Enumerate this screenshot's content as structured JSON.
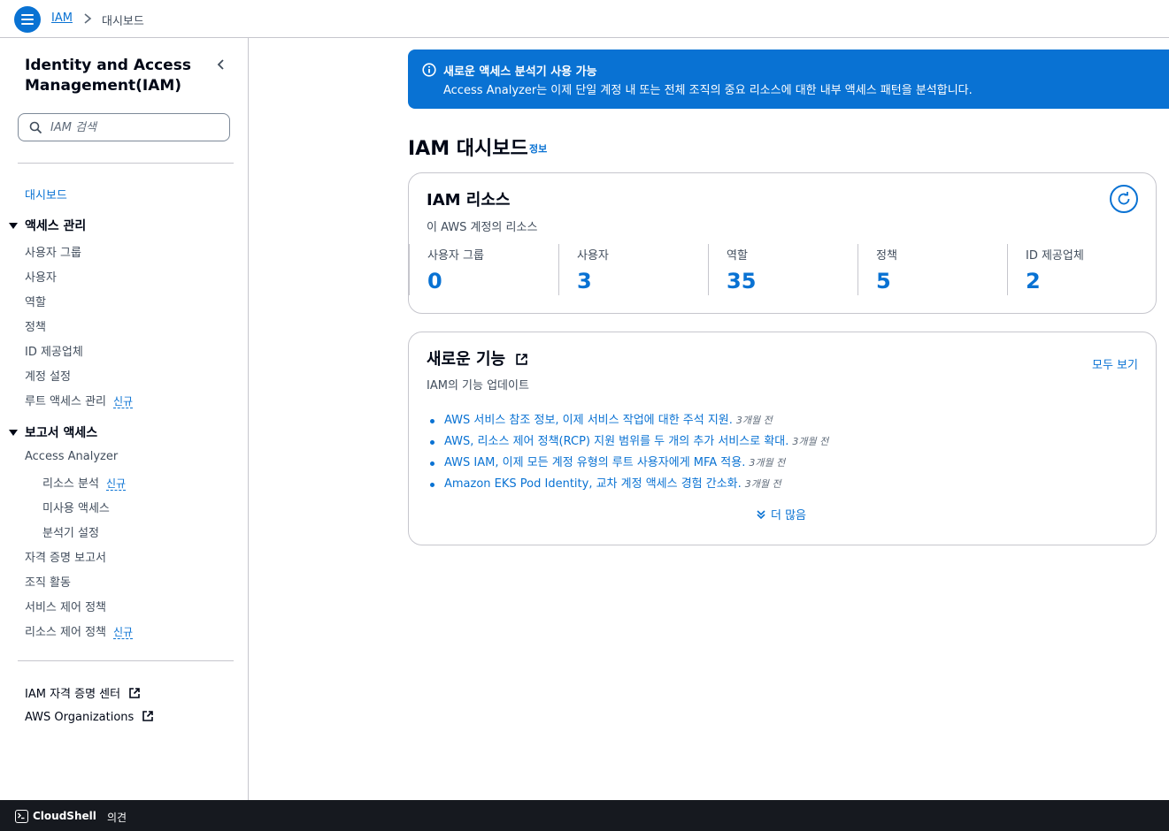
{
  "topbar": {
    "breadcrumb_root": "IAM",
    "breadcrumb_current": "대시보드"
  },
  "sidebar": {
    "title": "Identity and Access Management(IAM)",
    "search_placeholder": "IAM 검색",
    "dashboard": "대시보드",
    "section_access": "액세스 관리",
    "access_items": [
      "사용자 그룹",
      "사용자",
      "역할",
      "정책",
      "ID 제공업체",
      "계정 설정",
      "루트 액세스 관리"
    ],
    "section_reports": "보고서 액세스",
    "report_items": [
      "Access Analyzer",
      "리소스 분석",
      "미사용 액세스",
      "분석기 설정",
      "자격 증명 보고서",
      "조직 활동",
      "서비스 제어 정책",
      "리소스 제어 정책"
    ],
    "new_badge": "신규",
    "external_links": [
      "IAM 자격 증명 센터",
      "AWS Organizations"
    ]
  },
  "flash": {
    "title": "새로운 액세스 분석기 사용 가능",
    "body": "Access Analyzer는 이제 단일 계정 내 또는 전체 조직의 중요 리소스에 대한 내부 액세스 패턴을 분석합니다."
  },
  "main": {
    "title": "IAM 대시보드",
    "info_link": "정보"
  },
  "resources": {
    "title": "IAM 리소스",
    "description": "이 AWS 계정의 리소스",
    "metrics": [
      {
        "label": "사용자 그룹",
        "value": "0"
      },
      {
        "label": "사용자",
        "value": "3"
      },
      {
        "label": "역할",
        "value": "35"
      },
      {
        "label": "정책",
        "value": "5"
      },
      {
        "label": "ID 제공업체",
        "value": "2"
      }
    ]
  },
  "features": {
    "title": "새로운 기능",
    "view_all": "모두 보기",
    "description": "IAM의 기능 업데이트",
    "items": [
      {
        "text": "AWS 서비스 참조 정보, 이제 서비스 작업에 대한 주석 지원.",
        "age": "3개월 전"
      },
      {
        "text": "AWS, 리소스 제어 정책(RCP) 지원 범위를 두 개의 추가 서비스로 확대.",
        "age": "3개월 전"
      },
      {
        "text": "AWS IAM, 이제 모든 계정 유형의 루트 사용자에게 MFA 적용.",
        "age": "3개월 전"
      },
      {
        "text": "Amazon EKS Pod Identity, 교차 계정 액세스 경험 간소화.",
        "age": "3개월 전"
      }
    ],
    "more": "더 많음"
  },
  "bottombar": {
    "cloudshell": "CloudShell",
    "feedback": "의견"
  }
}
